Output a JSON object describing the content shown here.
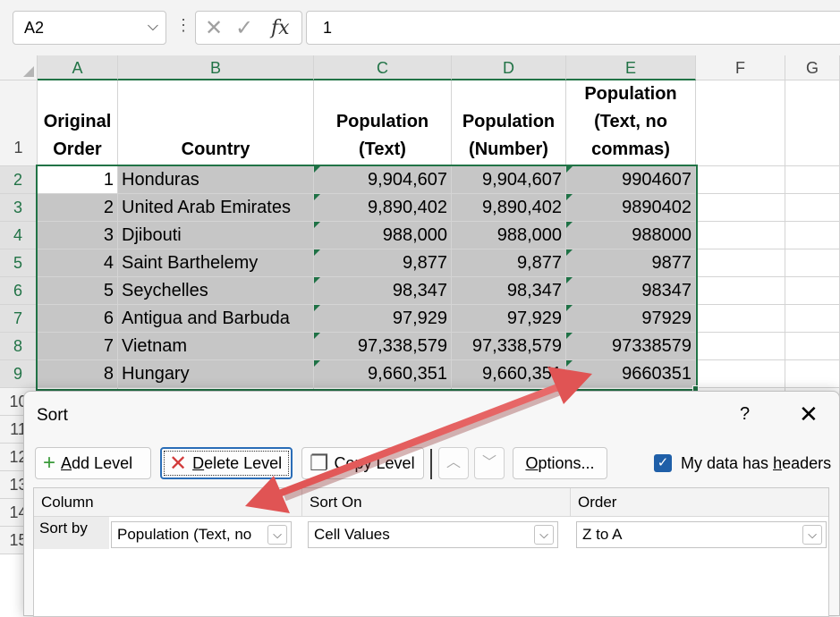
{
  "formula_bar": {
    "name_box": "A2",
    "formula": "1",
    "dots": "⋮",
    "cancel_glyph": "✕",
    "enter_glyph": "✓",
    "fx_label": "fx",
    "chevron_glyph": "⌵"
  },
  "columns": [
    "A",
    "B",
    "C",
    "D",
    "E",
    "F",
    "G"
  ],
  "rows": [
    "1",
    "2",
    "3",
    "4",
    "5",
    "6",
    "7",
    "8",
    "9",
    "10",
    "11",
    "12",
    "13",
    "14",
    "15"
  ],
  "headers": {
    "a": [
      "Original",
      "Order"
    ],
    "b": [
      "Country"
    ],
    "c": [
      "Population",
      "(Text)"
    ],
    "d": [
      "Population",
      "(Number)"
    ],
    "e": [
      "Population",
      "(Text, no",
      "commas)"
    ]
  },
  "data_rows": [
    {
      "order": "1",
      "country": "Honduras",
      "text": "9,904,607",
      "number": "9,904,607",
      "nocomma": "9904607"
    },
    {
      "order": "2",
      "country": "United Arab Emirates",
      "text": "9,890,402",
      "number": "9,890,402",
      "nocomma": "9890402"
    },
    {
      "order": "3",
      "country": "Djibouti",
      "text": "988,000",
      "number": "988,000",
      "nocomma": "988000"
    },
    {
      "order": "4",
      "country": "Saint Barthelemy",
      "text": "9,877",
      "number": "9,877",
      "nocomma": "9877"
    },
    {
      "order": "5",
      "country": "Seychelles",
      "text": "98,347",
      "number": "98,347",
      "nocomma": "98347"
    },
    {
      "order": "6",
      "country": "Antigua and Barbuda",
      "text": "97,929",
      "number": "97,929",
      "nocomma": "97929"
    },
    {
      "order": "7",
      "country": "Vietnam",
      "text": "97,338,579",
      "number": "97,338,579",
      "nocomma": "97338579"
    },
    {
      "order": "8",
      "country": "Hungary",
      "text": "9,660,351",
      "number": "9,660,351",
      "nocomma": "9660351"
    }
  ],
  "sort_dialog": {
    "title": "Sort",
    "help": "?",
    "close": "✕",
    "add_level": {
      "prefix": "A",
      "rest": "dd Level",
      "icon": "+"
    },
    "delete_level": {
      "prefix": "D",
      "rest": "elete Level",
      "icon": "✕"
    },
    "copy_level": {
      "prefix": "C",
      "rest": "opy Level",
      "icon": "❐"
    },
    "move_up": "︿",
    "move_down": "﹀",
    "options": {
      "prefix": "O",
      "rest": "ptions..."
    },
    "headers_checkbox": {
      "label_before": "My data has ",
      "label_accel": "h",
      "label_after": "eaders",
      "checked": true,
      "check_glyph": "✓"
    },
    "col_headers": [
      "Column",
      "Sort On",
      "Order"
    ],
    "row_label": "Sort by",
    "column_value": "Population (Text, no",
    "sort_on_value": "Cell Values",
    "order_value": "Z to A",
    "dropdown_glyph": "⌵"
  },
  "colors": {
    "excel_green": "#217346",
    "selection_fill": "#c6c6c6",
    "arrow_red": "#e05454",
    "checkbox_blue": "#1f5fa8"
  }
}
